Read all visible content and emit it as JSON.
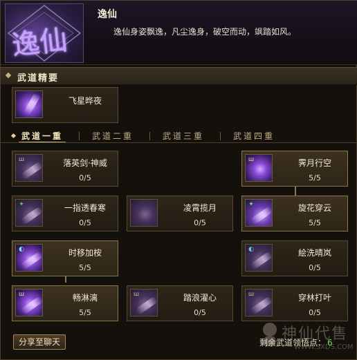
{
  "school": {
    "emblem_text": "逸仙",
    "name": "逸仙",
    "description": "逸仙身姿飘逸，凡尘逸身，破空而动，飒踏如风。"
  },
  "essence_section": {
    "title": "武道精要",
    "skill": {
      "name": "飞星晔夜",
      "icon": "purple-spirit-icon"
    }
  },
  "tabs": [
    {
      "label": "武道一重",
      "active": true
    },
    {
      "label": "武道二重",
      "active": false
    },
    {
      "label": "武道三重",
      "active": false
    },
    {
      "label": "武道四重",
      "active": false
    }
  ],
  "skills": [
    {
      "name": "落英剑·神威",
      "level": "0/5",
      "icon": "sword-slash-icon"
    },
    {
      "name": "霁月行空",
      "level": "5/5",
      "icon": "purple-figure-icon"
    },
    {
      "name": "一指透春寒",
      "level": "0/5",
      "icon": "finger-strike-icon"
    },
    {
      "name": "凌霄揽月",
      "level": "0/5",
      "icon": "moon-vortex-icon"
    },
    {
      "name": "旋花穿云",
      "level": "5/5",
      "icon": "spinning-blade-icon"
    },
    {
      "name": "时移加桉",
      "level": "5/5",
      "icon": "time-shift-icon"
    },
    {
      "name": "絵洗晴岚",
      "level": "0/5",
      "icon": "mist-wave-icon"
    },
    {
      "name": "畅淋漓",
      "level": "5/5",
      "icon": "flowing-strike-icon"
    },
    {
      "name": "踏浪濯心",
      "level": "0/5",
      "icon": "wave-step-icon"
    },
    {
      "name": "穿林打叶",
      "level": "0/5",
      "icon": "leaf-strike-icon"
    }
  ],
  "footer": {
    "share_label": "分享至聊天",
    "points_label": "剩余武道领悟点：",
    "points_value": "6"
  },
  "watermark": {
    "text": "神仙代售",
    "url": "WWW.SXDS.COM"
  }
}
